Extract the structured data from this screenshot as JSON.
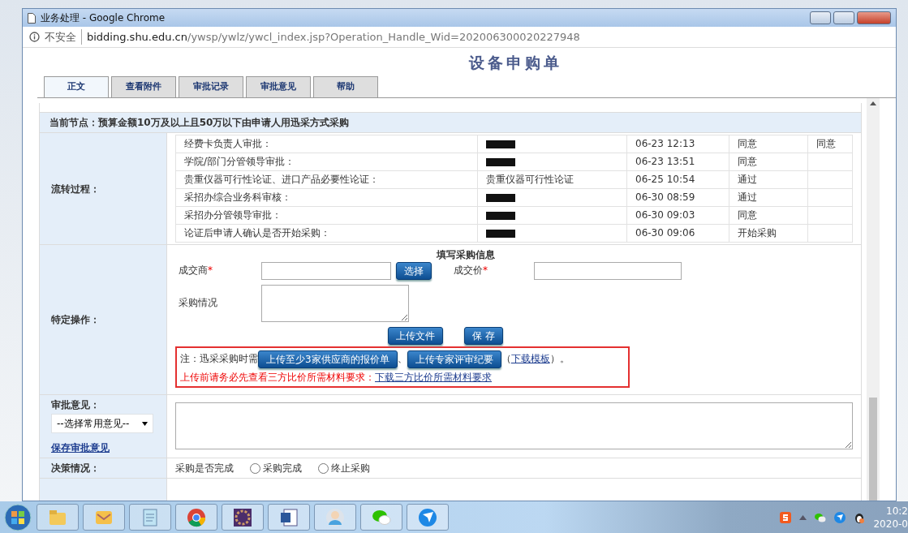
{
  "window": {
    "title": "业务处理 - Google Chrome"
  },
  "address_bar": {
    "security": "不安全",
    "host": "bidding.shu.edu.cn",
    "path": "/ywsp/ywlz/ywcl_index.jsp?Operation_Handle_Wid=202006300020227948"
  },
  "page_title": "设备申购单",
  "tabs": [
    {
      "label": "正文",
      "selected": true
    },
    {
      "label": "查看附件",
      "selected": false
    },
    {
      "label": "审批记录",
      "selected": false
    },
    {
      "label": "审批意见",
      "selected": false
    },
    {
      "label": "帮助",
      "selected": false
    }
  ],
  "current_node": "当前节点：预算金额10万及以上且50万以下由申请人用迅采方式采购",
  "flow": {
    "label": "流转过程：",
    "steps": [
      {
        "step": "经费卡负责人审批：",
        "redacted": true,
        "time": "06-23 12:13",
        "result": "同意",
        "comment": "同意"
      },
      {
        "step": "学院/部门分管领导审批：",
        "redacted": true,
        "time": "06-23 13:51",
        "result": "同意"
      },
      {
        "step": "贵重仪器可行性论证、进口产品必要性论证：",
        "handler": "贵重仪器可行性论证",
        "redacted": false,
        "time": "06-25 10:54",
        "result": "通过"
      },
      {
        "step": "采招办综合业务科审核：",
        "redacted": true,
        "time": "06-30 08:59",
        "result": "通过"
      },
      {
        "step": "采招办分管领导审批：",
        "redacted": true,
        "time": "06-30 09:03",
        "result": "同意"
      },
      {
        "step": "论证后申请人确认是否开始采购：",
        "redacted": true,
        "time": "06-30 09:06",
        "result": "开始采购"
      }
    ]
  },
  "operation": {
    "label": "特定操作：",
    "form_title": "填写采购信息",
    "vendor": {
      "label": "成交商",
      "asterisk": "*",
      "button": "选择"
    },
    "price": {
      "label": "成交价",
      "asterisk": "*"
    },
    "situation": {
      "label": "采购情况"
    },
    "buttons": [
      "上传文件",
      "保 存"
    ],
    "notice": [
      [
        {
          "kind": "text",
          "text": "注：迅采采购时需"
        },
        {
          "kind": "button",
          "text": "上传至少3家供应商的报价单"
        },
        {
          "kind": "text",
          "text": "、"
        },
        {
          "kind": "button",
          "text": "上传专家评审纪要"
        },
        {
          "kind": "text",
          "text": "（"
        },
        {
          "kind": "link",
          "text": "下载模板"
        },
        {
          "kind": "text",
          "text": "）。"
        }
      ],
      [
        {
          "kind": "warning",
          "text": "上传前请务必先查看三方比价所需材料要求："
        },
        {
          "kind": "link",
          "text": "下载三方比价所需材料要求"
        }
      ]
    ]
  },
  "opinion": {
    "label": "审批意见：",
    "select": "--选择常用意见--",
    "save_link": "保存审批意见"
  },
  "decision": {
    "label": "决策情况：",
    "question": "采购是否完成",
    "options": [
      {
        "label": "采购完成",
        "selected": false
      },
      {
        "label": "终止采购",
        "selected": false
      }
    ]
  },
  "clock": {
    "time": "10:2",
    "date": "2020-0"
  }
}
